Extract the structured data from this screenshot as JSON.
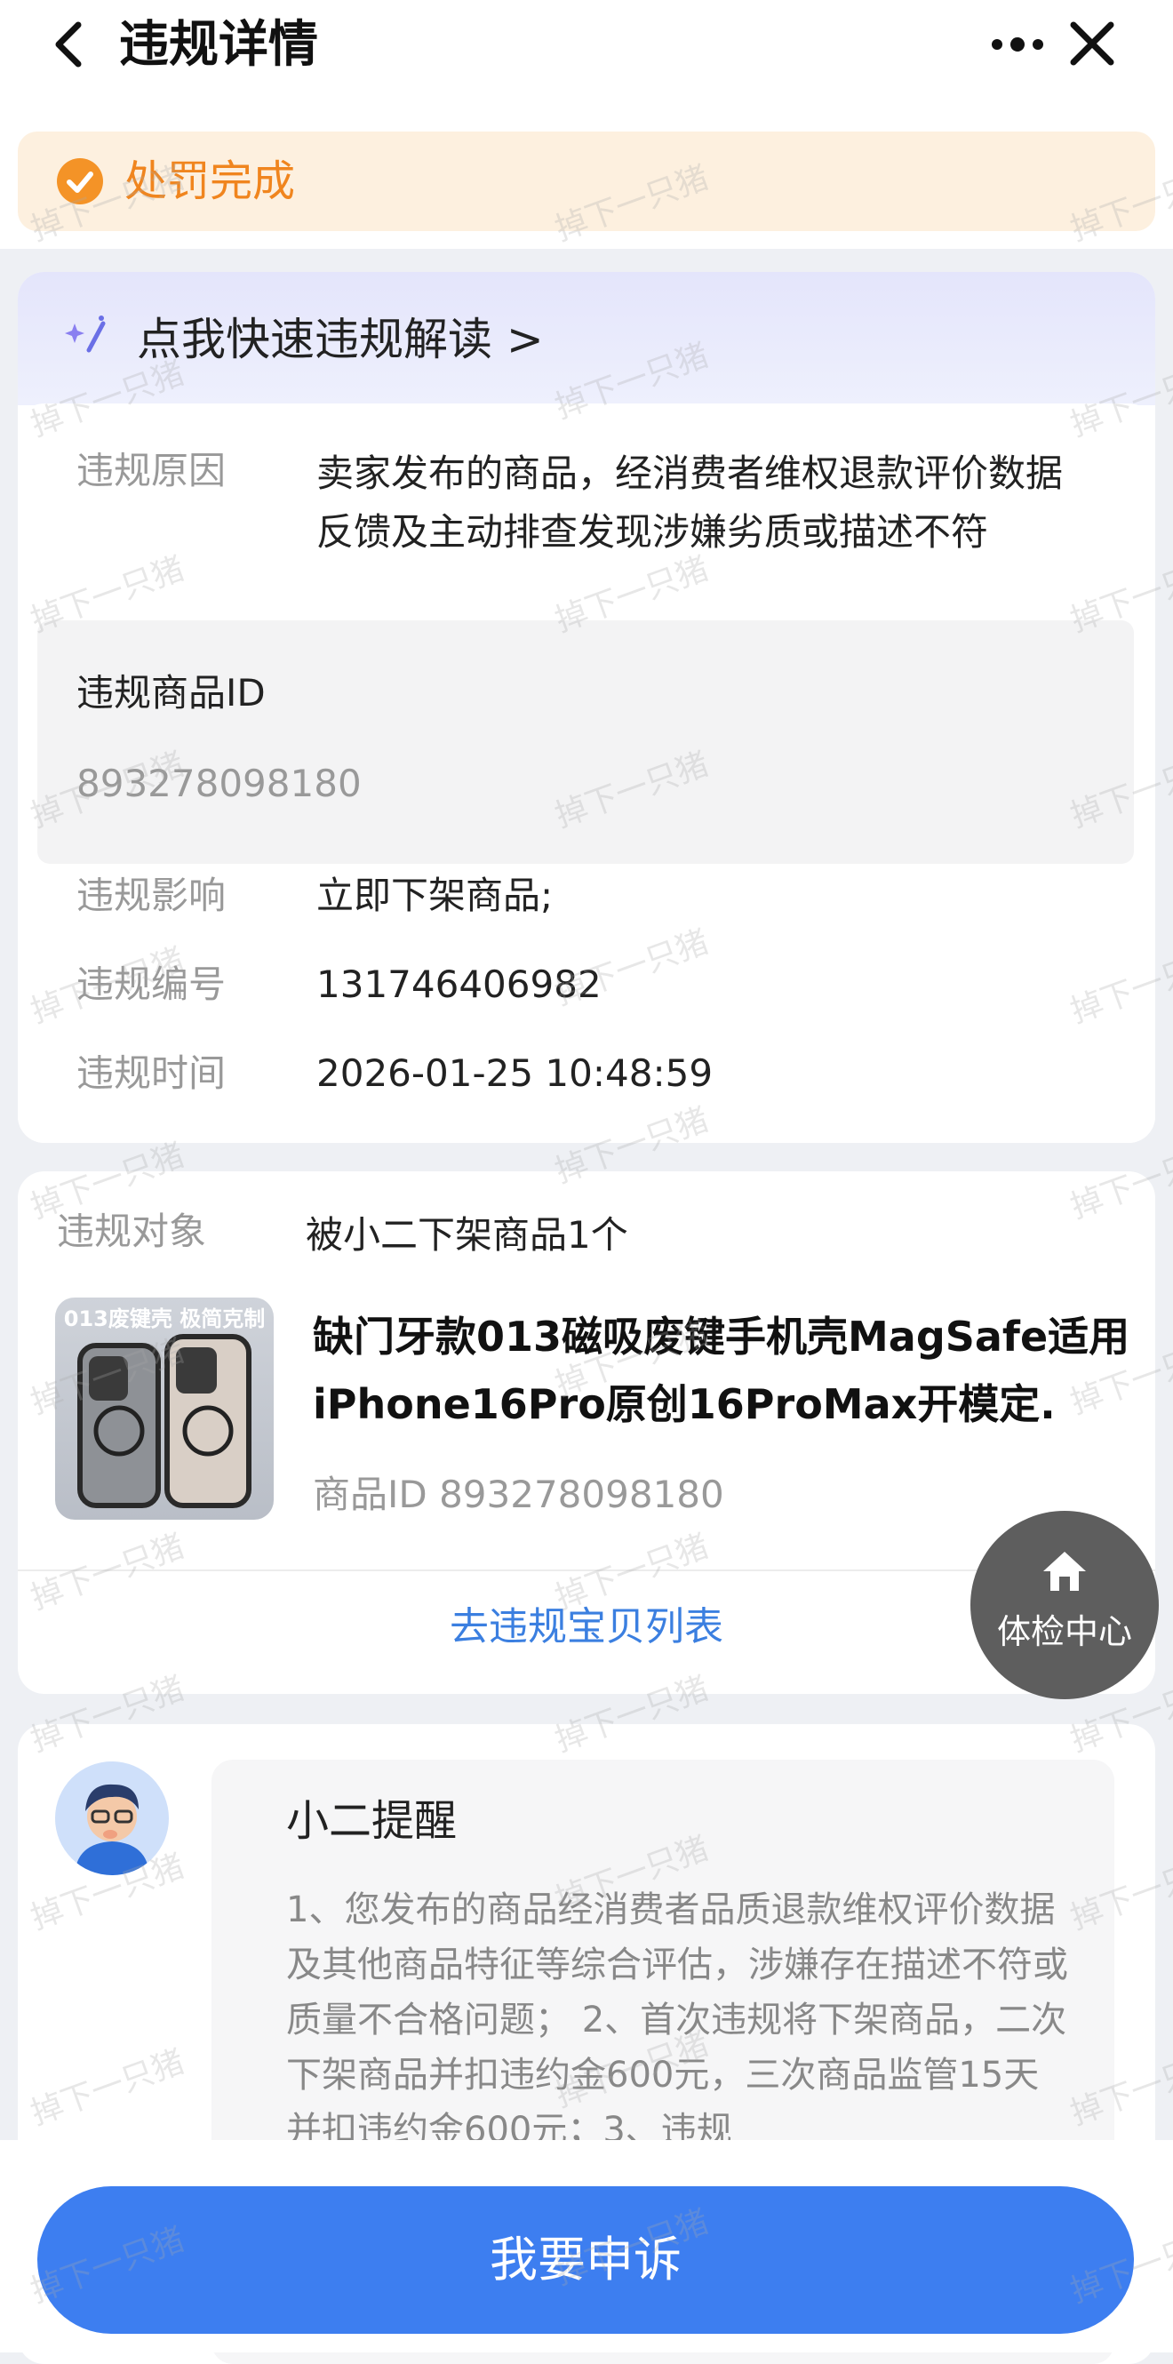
{
  "header": {
    "title": "违规详情",
    "back_icon": "chevron-left",
    "more_icon": "more-dots",
    "close_icon": "close-x"
  },
  "status": {
    "text": "处罚完成",
    "color": "#f0851e"
  },
  "quick_read": {
    "text": "点我快速违规解读 >"
  },
  "details": {
    "reason_label": "违规原因",
    "reason_value": "卖家发布的商品，经消费者维权退款评价数据反馈及主动排查发现涉嫌劣质或描述不符",
    "product_id_label": "违规商品ID",
    "product_id_value": "893278098180",
    "impact_label": "违规影响",
    "impact_value": "立即下架商品;",
    "number_label": "违规编号",
    "number_value": "131746406982",
    "time_label": "违规时间",
    "time_value": "2026-01-25 10:48:59"
  },
  "target": {
    "label": "违规对象",
    "value": "被小二下架商品1个",
    "thumb_caption": "013废键壳 极简克制",
    "product_title": "缺门牙款013磁吸废键手机壳MagSafe适用iPhone16Pro原创16ProMax开模定.",
    "product_id_text": "商品ID 893278098180",
    "list_link": "去违规宝贝列表"
  },
  "float_button": {
    "label": "体检中心",
    "icon": "home-icon"
  },
  "reminder": {
    "title": "小二提醒",
    "body": "1、您发布的商品经消费者品质退款维权评价数据及其他商品特征等综合评估，涉嫌存在描述不符或质量不合格问题； 2、首次违规将下架商品，二次下架商品并扣违约金600元，三次商品监管15天并扣违约金600元；3、违规"
  },
  "footer": {
    "appeal_label": "我要申诉",
    "accent": "#3d7ef0"
  },
  "watermark": "掉下一只猪"
}
